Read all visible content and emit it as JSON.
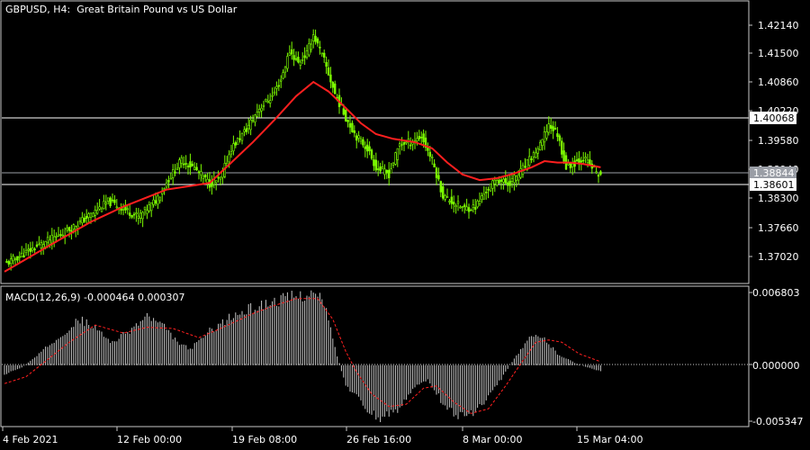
{
  "header": {
    "symbol": "GBPUSD, H4:",
    "description": "Great Britain Pound vs US Dollar"
  },
  "macd_header": {
    "label": "MACD(12,26,9) -0.000464 0.000307"
  },
  "colors": {
    "background": "#000000",
    "bull_candle": "#7CFC00",
    "ma_line": "#ff1f1f",
    "frame": "#c8c8c8",
    "macd_histogram": "#c8c8c8",
    "macd_signal": "#ff1f1f",
    "current_price_box": "#9a9ea6",
    "level_box": "#ffffff"
  },
  "price_axis": {
    "ticks": [
      "1.42140",
      "1.41500",
      "1.40860",
      "1.40220",
      "1.39580",
      "1.38940",
      "1.38300",
      "1.37660",
      "1.37020"
    ],
    "level_1": "1.40068",
    "level_2": "1.38601",
    "current": "1.38844"
  },
  "macd_axis": {
    "ticks": [
      "0.006803",
      "0.000000",
      "-0.005347"
    ]
  },
  "time_axis": {
    "labels": [
      "4 Feb 2021",
      "12 Feb 00:00",
      "19 Feb 08:00",
      "26 Feb 16:00",
      "8 Mar 00:00",
      "15 Mar 04:00"
    ]
  },
  "chart_data": [
    {
      "type": "candlestick",
      "title": "GBPUSD, H4: Great Britain Pound vs US Dollar",
      "instrument": "GBPUSD",
      "timeframe": "H4",
      "ylim": [
        1.366,
        1.4254
      ],
      "x_labels": [
        "4 Feb 2021",
        "12 Feb 00:00",
        "19 Feb 08:00",
        "26 Feb 16:00",
        "8 Mar 00:00",
        "15 Mar 04:00"
      ],
      "horizontal_levels": [
        1.40068,
        1.38601
      ],
      "current_price": 1.38844,
      "close_path": [
        [
          0,
          1.37
        ],
        [
          15,
          1.3738
        ],
        [
          28,
          1.3768
        ],
        [
          40,
          1.3805
        ],
        [
          48,
          1.3833
        ],
        [
          55,
          1.3818
        ],
        [
          62,
          1.38
        ],
        [
          70,
          1.3835
        ],
        [
          76,
          1.388
        ],
        [
          82,
          1.392
        ],
        [
          88,
          1.3903
        ],
        [
          95,
          1.387
        ],
        [
          100,
          1.388
        ],
        [
          105,
          1.3945
        ],
        [
          112,
          1.3985
        ],
        [
          118,
          1.403
        ],
        [
          124,
          1.4055
        ],
        [
          128,
          1.409
        ],
        [
          132,
          1.415
        ],
        [
          136,
          1.4125
        ],
        [
          140,
          1.4145
        ],
        [
          143,
          1.4185
        ],
        [
          148,
          1.413
        ],
        [
          153,
          1.406
        ],
        [
          158,
          1.401
        ],
        [
          163,
          1.397
        ],
        [
          168,
          1.3945
        ],
        [
          172,
          1.3905
        ],
        [
          178,
          1.389
        ],
        [
          183,
          1.3955
        ],
        [
          188,
          1.3958
        ],
        [
          193,
          1.397
        ],
        [
          198,
          1.392
        ],
        [
          203,
          1.3845
        ],
        [
          208,
          1.383
        ],
        [
          213,
          1.3818
        ],
        [
          218,
          1.3822
        ],
        [
          223,
          1.3855
        ],
        [
          228,
          1.388
        ],
        [
          233,
          1.387
        ],
        [
          238,
          1.389
        ],
        [
          243,
          1.392
        ],
        [
          248,
          1.395
        ],
        [
          252,
          1.3995
        ],
        [
          256,
          1.3975
        ],
        [
          260,
          1.3905
        ],
        [
          264,
          1.3915
        ],
        [
          268,
          1.3925
        ],
        [
          272,
          1.3905
        ],
        [
          276,
          1.3885
        ]
      ],
      "series": [
        {
          "name": "",
          "type": "moving-average",
          "points": [
            [
              0,
              1.3685
            ],
            [
              20,
              1.3738
            ],
            [
              40,
              1.379
            ],
            [
              55,
              1.3822
            ],
            [
              65,
              1.384
            ],
            [
              75,
              1.3858
            ],
            [
              85,
              1.3865
            ],
            [
              95,
              1.3872
            ],
            [
              105,
              1.3915
            ],
            [
              115,
              1.3958
            ],
            [
              125,
              1.4005
            ],
            [
              135,
              1.4055
            ],
            [
              143,
              1.4085
            ],
            [
              150,
              1.4065
            ],
            [
              158,
              1.403
            ],
            [
              165,
              1.3998
            ],
            [
              172,
              1.3975
            ],
            [
              180,
              1.3965
            ],
            [
              190,
              1.3958
            ],
            [
              198,
              1.3945
            ],
            [
              205,
              1.3915
            ],
            [
              212,
              1.389
            ],
            [
              220,
              1.3878
            ],
            [
              228,
              1.3882
            ],
            [
              236,
              1.3892
            ],
            [
              244,
              1.3905
            ],
            [
              250,
              1.3918
            ],
            [
              256,
              1.3915
            ],
            [
              262,
              1.3915
            ],
            [
              268,
              1.3912
            ],
            [
              276,
              1.3905
            ]
          ]
        }
      ]
    },
    {
      "type": "histogram",
      "title": "MACD(12,26,9) -0.000464 0.000307",
      "ylim": [
        -0.005347,
        0.006803
      ],
      "macd_value": -0.000464,
      "signal_value": 0.000307,
      "histogram_path": [
        [
          0,
          -0.0008
        ],
        [
          8,
          -0.0002
        ],
        [
          15,
          0.0008
        ],
        [
          25,
          0.0025
        ],
        [
          35,
          0.004
        ],
        [
          42,
          0.0032
        ],
        [
          50,
          0.002
        ],
        [
          58,
          0.003
        ],
        [
          66,
          0.0043
        ],
        [
          74,
          0.0033
        ],
        [
          80,
          0.002
        ],
        [
          86,
          0.0014
        ],
        [
          95,
          0.003
        ],
        [
          105,
          0.0042
        ],
        [
          115,
          0.005
        ],
        [
          125,
          0.0056
        ],
        [
          135,
          0.006
        ],
        [
          142,
          0.0063
        ],
        [
          148,
          0.0055
        ],
        [
          153,
          0.0015
        ],
        [
          158,
          -0.0018
        ],
        [
          163,
          -0.0028
        ],
        [
          168,
          -0.004
        ],
        [
          174,
          -0.0048
        ],
        [
          182,
          -0.0038
        ],
        [
          190,
          -0.002
        ],
        [
          196,
          -0.0012
        ],
        [
          202,
          -0.003
        ],
        [
          208,
          -0.0042
        ],
        [
          214,
          -0.0045
        ],
        [
          222,
          -0.0034
        ],
        [
          230,
          -0.0012
        ],
        [
          236,
          0.0006
        ],
        [
          244,
          0.0025
        ],
        [
          250,
          0.0023
        ],
        [
          256,
          0.001
        ],
        [
          264,
          0.0002
        ],
        [
          270,
          -0.0002
        ],
        [
          276,
          -0.0005
        ]
      ],
      "signal_path": [
        [
          0,
          -0.0016
        ],
        [
          10,
          -0.001
        ],
        [
          20,
          0.0005
        ],
        [
          30,
          0.002
        ],
        [
          42,
          0.0035
        ],
        [
          55,
          0.0028
        ],
        [
          66,
          0.0033
        ],
        [
          78,
          0.0032
        ],
        [
          90,
          0.0024
        ],
        [
          100,
          0.0032
        ],
        [
          115,
          0.0045
        ],
        [
          125,
          0.0052
        ],
        [
          135,
          0.0058
        ],
        [
          145,
          0.0058
        ],
        [
          152,
          0.004
        ],
        [
          158,
          0.0012
        ],
        [
          163,
          -0.0006
        ],
        [
          170,
          -0.0025
        ],
        [
          178,
          -0.0036
        ],
        [
          186,
          -0.0034
        ],
        [
          194,
          -0.002
        ],
        [
          200,
          -0.0018
        ],
        [
          208,
          -0.0032
        ],
        [
          216,
          -0.0042
        ],
        [
          224,
          -0.0038
        ],
        [
          232,
          -0.0018
        ],
        [
          240,
          0.0004
        ],
        [
          246,
          0.002
        ],
        [
          252,
          0.0022
        ],
        [
          258,
          0.002
        ],
        [
          266,
          0.001
        ],
        [
          276,
          0.0003
        ]
      ]
    }
  ]
}
